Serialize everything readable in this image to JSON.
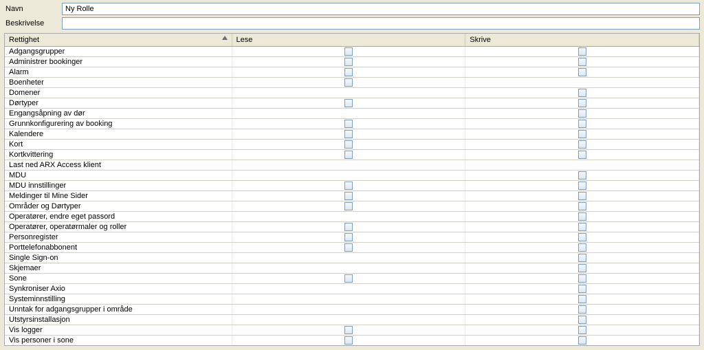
{
  "form": {
    "name_label": "Navn",
    "name_value": "Ny Rolle",
    "desc_label": "Beskrivelse",
    "desc_value": ""
  },
  "columns": {
    "rettighet": "Rettighet",
    "lese": "Lese",
    "skrive": "Skrive"
  },
  "rows": [
    {
      "name": "Adgangsgrupper",
      "lese": true,
      "skrive": true
    },
    {
      "name": "Administrer bookinger",
      "lese": true,
      "skrive": true
    },
    {
      "name": "Alarm",
      "lese": true,
      "skrive": true
    },
    {
      "name": "Boenheter",
      "lese": true,
      "skrive": false
    },
    {
      "name": "Domener",
      "lese": false,
      "skrive": true
    },
    {
      "name": "Dørtyper",
      "lese": true,
      "skrive": true
    },
    {
      "name": "Engangsåpning av dør",
      "lese": false,
      "skrive": true
    },
    {
      "name": "Grunnkonfigurering av booking",
      "lese": true,
      "skrive": true
    },
    {
      "name": "Kalendere",
      "lese": true,
      "skrive": true
    },
    {
      "name": "Kort",
      "lese": true,
      "skrive": true
    },
    {
      "name": "Kortkvittering",
      "lese": true,
      "skrive": true
    },
    {
      "name": "Last ned ARX Access klient",
      "lese": false,
      "skrive": false
    },
    {
      "name": "MDU",
      "lese": false,
      "skrive": true
    },
    {
      "name": "MDU innstillinger",
      "lese": true,
      "skrive": true
    },
    {
      "name": "Meldinger til Mine Sider",
      "lese": true,
      "skrive": true
    },
    {
      "name": "Områder og Dørtyper",
      "lese": true,
      "skrive": true
    },
    {
      "name": "Operatører, endre eget passord",
      "lese": false,
      "skrive": true
    },
    {
      "name": "Operatører, operatørmaler og roller",
      "lese": true,
      "skrive": true
    },
    {
      "name": "Personregister",
      "lese": true,
      "skrive": true
    },
    {
      "name": "Porttelefonabbonent",
      "lese": true,
      "skrive": true
    },
    {
      "name": "Single Sign-on",
      "lese": false,
      "skrive": true
    },
    {
      "name": "Skjemaer",
      "lese": false,
      "skrive": true
    },
    {
      "name": "Sone",
      "lese": true,
      "skrive": true
    },
    {
      "name": "Synkroniser Axio",
      "lese": false,
      "skrive": true
    },
    {
      "name": "Systeminnstilling",
      "lese": false,
      "skrive": true
    },
    {
      "name": "Unntak for adgangsgrupper i område",
      "lese": false,
      "skrive": true
    },
    {
      "name": "Utstyrsinstallasjon",
      "lese": false,
      "skrive": true
    },
    {
      "name": "Vis logger",
      "lese": true,
      "skrive": true
    },
    {
      "name": "Vis personer i sone",
      "lese": true,
      "skrive": true
    }
  ]
}
